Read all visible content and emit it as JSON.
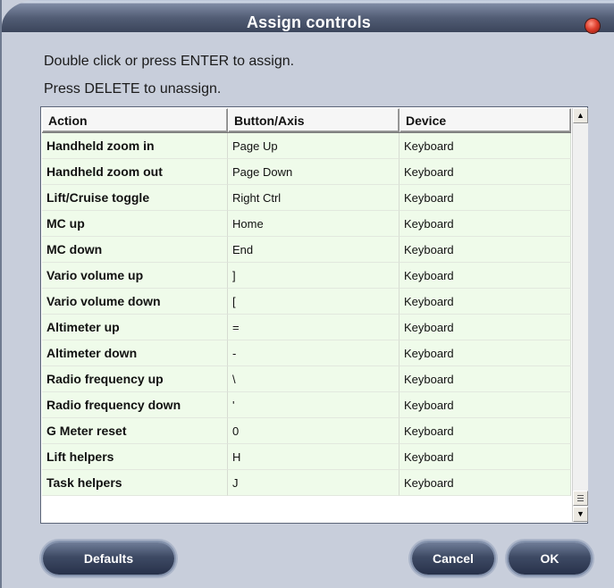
{
  "window": {
    "title": "Assign controls"
  },
  "instructions": [
    "Double click or press ENTER to assign.",
    "Press DELETE to unassign."
  ],
  "table": {
    "headers": [
      "Action",
      "Button/Axis",
      "Device"
    ],
    "rows": [
      [
        "Handheld zoom in",
        "Page Up",
        "Keyboard"
      ],
      [
        "Handheld zoom out",
        "Page Down",
        "Keyboard"
      ],
      [
        "Lift/Cruise toggle",
        "Right Ctrl",
        "Keyboard"
      ],
      [
        "MC up",
        "Home",
        "Keyboard"
      ],
      [
        "MC down",
        "End",
        "Keyboard"
      ],
      [
        "Vario volume up",
        "]",
        "Keyboard"
      ],
      [
        "Vario volume down",
        "[",
        "Keyboard"
      ],
      [
        "Altimeter up",
        "=",
        "Keyboard"
      ],
      [
        "Altimeter down",
        "-",
        "Keyboard"
      ],
      [
        "Radio frequency up",
        "\\",
        "Keyboard"
      ],
      [
        "Radio frequency down",
        "'",
        "Keyboard"
      ],
      [
        "G Meter reset",
        "0",
        "Keyboard"
      ],
      [
        "Lift helpers",
        "H",
        "Keyboard"
      ],
      [
        "Task helpers",
        "J",
        "Keyboard"
      ]
    ]
  },
  "buttons": {
    "defaults": "Defaults",
    "cancel": "Cancel",
    "ok": "OK"
  },
  "colors": {
    "row_background": "#effbea",
    "titlebar": "#3b455b",
    "close_button": "#e0402e"
  },
  "icons": {
    "close": "close-icon",
    "scroll_up": "arrow-up-icon",
    "scroll_down": "arrow-down-icon"
  }
}
